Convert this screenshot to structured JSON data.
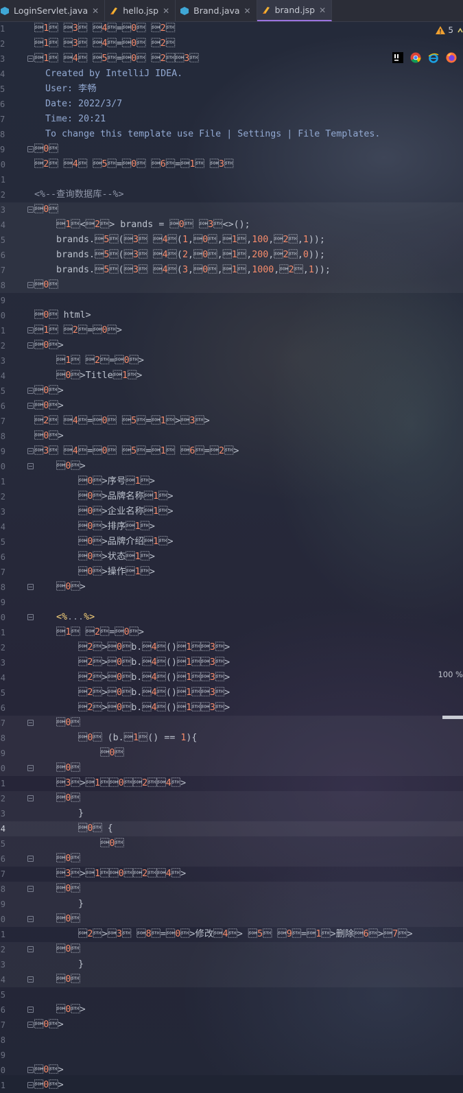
{
  "tabs": [
    {
      "label": "LoginServlet.java",
      "icon": "java-class-icon",
      "active": false
    },
    {
      "label": "hello.jsp",
      "icon": "jsp-file-icon",
      "active": false
    },
    {
      "label": "Brand.java",
      "icon": "java-class-icon",
      "active": false
    },
    {
      "label": "brand.jsp",
      "icon": "jsp-file-icon",
      "active": true
    }
  ],
  "warnings": {
    "count": "5"
  },
  "browsers": [
    "intellij-browser-icon",
    "chrome-icon",
    "ie-icon",
    "firefox-icon"
  ],
  "zoom": "100 %",
  "editor": {
    "current_line": 54,
    "lines": [
      {
        "n": "1",
        "code": "<%@ page import=\"com.pojo.Brand\" %>"
      },
      {
        "n": "2",
        "code": "<%@ page import=\"java.util.List\" %>"
      },
      {
        "n": "3",
        "code": "<%@ page import=\"java.util.ArrayList\" %><%--"
      },
      {
        "n": "4",
        "code": "  Created by IntelliJ IDEA."
      },
      {
        "n": "5",
        "code": "  User: 李畅"
      },
      {
        "n": "6",
        "code": "  Date: 2022/3/7"
      },
      {
        "n": "7",
        "code": "  Time: 20:21"
      },
      {
        "n": "8",
        "code": "  To change this template use File | Settings | File Templates."
      },
      {
        "n": "9",
        "code": "--%>"
      },
      {
        "n": "10",
        "code": "<%@ page contentType=\"text/html;charset=UTF-8\" language=\"java\" %>"
      },
      {
        "n": "11",
        "code": ""
      },
      {
        "n": "12",
        "code": "<%--查询数据库--%>"
      },
      {
        "n": "13",
        "code": "<%"
      },
      {
        "n": "14",
        "code": "    List<Brand> brands = new ArrayList<>();"
      },
      {
        "n": "15",
        "code": "    brands.add(new Brand(1,\"三只松鼠\",\"三只松鼠\",100,\"三只松鼠，好吃不上火\",1));"
      },
      {
        "n": "16",
        "code": "    brands.add(new Brand(2,\"优衣库\",\"优衣库\",200,\"优衣库，服适人生\",0));"
      },
      {
        "n": "17",
        "code": "    brands.add(new Brand(3,\"小米\",\"小米科技有限公司\",1000,\"为发烧而生\",1));"
      },
      {
        "n": "18",
        "code": "%>"
      },
      {
        "n": "19",
        "code": ""
      },
      {
        "n": "20",
        "code": "<!DOCTYPE html>"
      },
      {
        "n": "21",
        "code": "<html lang=\"en\">"
      },
      {
        "n": "22",
        "code": "<head>"
      },
      {
        "n": "23",
        "code": "    <meta charset=\"UTF-8\">"
      },
      {
        "n": "24",
        "code": "    <title>Title</title>"
      },
      {
        "n": "25",
        "code": "</head>"
      },
      {
        "n": "26",
        "code": "<body>"
      },
      {
        "n": "27",
        "code": "<input type=\"button\" value=\"新增\"><br>"
      },
      {
        "n": "28",
        "code": "<hr>"
      },
      {
        "n": "29",
        "code": "<table border=\"1\" cellspacing=\"0\" width=\"800\">"
      },
      {
        "n": "30",
        "code": "    <tr>"
      },
      {
        "n": "31",
        "code": "        <th>序号</th>"
      },
      {
        "n": "32",
        "code": "        <th>品牌名称</th>"
      },
      {
        "n": "33",
        "code": "        <th>企业名称</th>"
      },
      {
        "n": "34",
        "code": "        <th>排序</th>"
      },
      {
        "n": "35",
        "code": "        <th>品牌介绍</th>"
      },
      {
        "n": "36",
        "code": "        <th>状态</th>"
      },
      {
        "n": "37",
        "code": "        <th>操作</th>"
      },
      {
        "n": "38",
        "code": "    </tr>"
      },
      {
        "n": "39",
        "code": ""
      },
      {
        "n": "40",
        "code": "    <%...%>"
      },
      {
        "n": "41",
        "code": "    <tr align=\"center\">"
      },
      {
        "n": "42",
        "code": "        <td><%=b.getId()%></td>"
      },
      {
        "n": "43",
        "code": "        <td><%=b.getBrandName()%></td>"
      },
      {
        "n": "44",
        "code": "        <td><%=b.getCompanyName()%></td>"
      },
      {
        "n": "45",
        "code": "        <td><%=b.getOrdered()%></td>"
      },
      {
        "n": "46",
        "code": "        <td><%=b.getDescription()%></td>"
      },
      {
        "n": "47",
        "code": "    <%"
      },
      {
        "n": "48",
        "code": "        if (b.getStatus() == 1){"
      },
      {
        "n": "49",
        "code": "            // 显示启用"
      },
      {
        "n": "50",
        "code": "    %>"
      },
      {
        "n": "51",
        "code": "    <td><%=\"启用\"%></td>"
      },
      {
        "n": "52",
        "code": "    <%"
      },
      {
        "n": "53",
        "code": "        }"
      },
      {
        "n": "54",
        "code": "        else {"
      },
      {
        "n": "55",
        "code": "            // 显示禁用"
      },
      {
        "n": "56",
        "code": "    %>"
      },
      {
        "n": "57",
        "code": "    <td><%=\"禁用\"%></td>"
      },
      {
        "n": "58",
        "code": "    <%"
      },
      {
        "n": "59",
        "code": "        }"
      },
      {
        "n": "60",
        "code": "    %>"
      },
      {
        "n": "61",
        "code": "        <td><a href=\"#\">修改</a> <a href=\"#\">删除</a></td>"
      },
      {
        "n": "62",
        "code": "    <%"
      },
      {
        "n": "63",
        "code": "        }"
      },
      {
        "n": "64",
        "code": "    %>"
      },
      {
        "n": "65",
        "code": ""
      },
      {
        "n": "66",
        "code": "    </tr>"
      },
      {
        "n": "67",
        "code": "</table>"
      },
      {
        "n": "68",
        "code": ""
      },
      {
        "n": "69",
        "code": ""
      },
      {
        "n": "70",
        "code": "</body>"
      },
      {
        "n": "71",
        "code": "</html>"
      }
    ]
  }
}
